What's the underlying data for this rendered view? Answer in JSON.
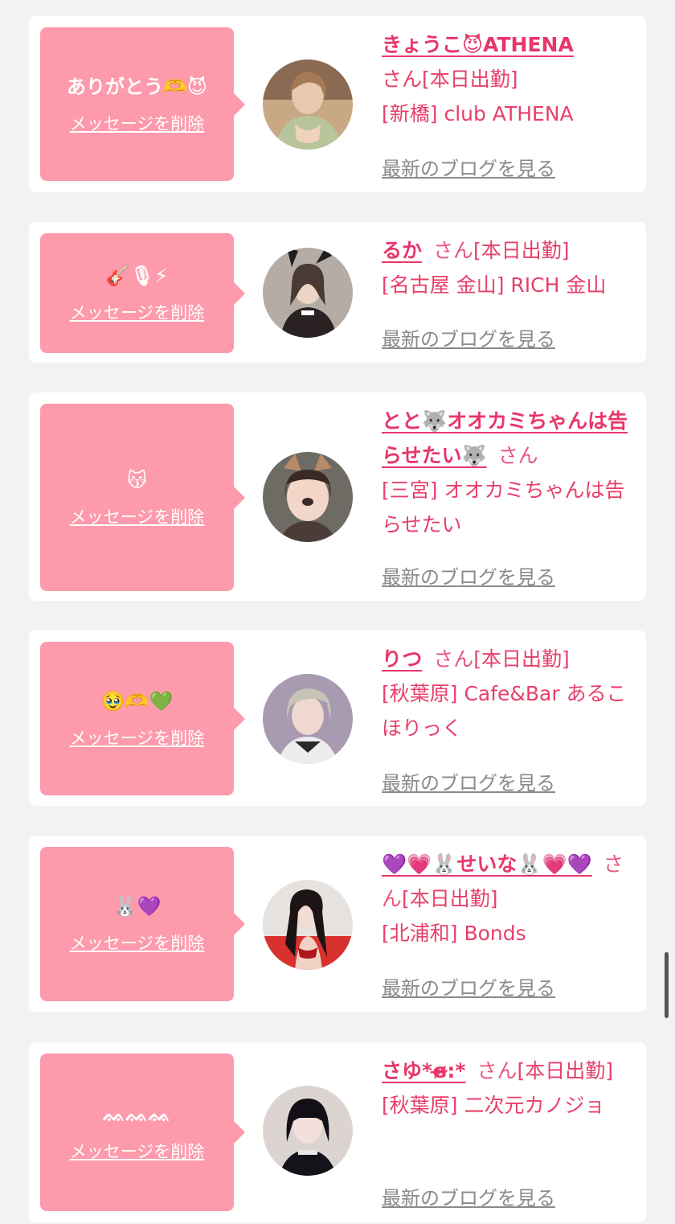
{
  "delete_label": "メッセージを削除",
  "blog_label": "最新のブログを見る",
  "cards": [
    {
      "message": "ありがとう🫶😈",
      "name": "きょうこ😈ATHENA",
      "san": "さん",
      "status": "[本日出勤]",
      "shop": "[新橋] club ATHENA"
    },
    {
      "message": "🎸🎙⚡",
      "name": "るか",
      "san": "さん",
      "status": "[本日出勤]",
      "shop": "[名古屋 金山] RICH 金山"
    },
    {
      "message": "😽",
      "name": "とと🐺オオカミちゃんは告らせたい🐺",
      "san": "さん",
      "status": "",
      "shop": "[三宮] オオカミちゃんは告らせたい"
    },
    {
      "message": "🥹🫶💚",
      "name": "りつ",
      "san": "さん",
      "status": "[本日出勤]",
      "shop": "[秋葉原] Cafe&Bar あるこほりっく"
    },
    {
      "message": "🐰💜",
      "name": "💜💗🐰せいな🐰💗💜",
      "san": "さん",
      "status": "[本日出勤]",
      "shop": "[北浦和] Bonds"
    },
    {
      "message": "ᨐᨐᨐ",
      "name": "さゆ*ɞ̴̶̷:*",
      "san": "さん",
      "status": "[本日出勤]",
      "shop": "[秋葉原] 二次元カノジョ"
    }
  ],
  "colors": {
    "bubble": "#fd9aab",
    "name": "#e8366a",
    "text": "#e83f6a",
    "link": "#8a8a8a"
  }
}
